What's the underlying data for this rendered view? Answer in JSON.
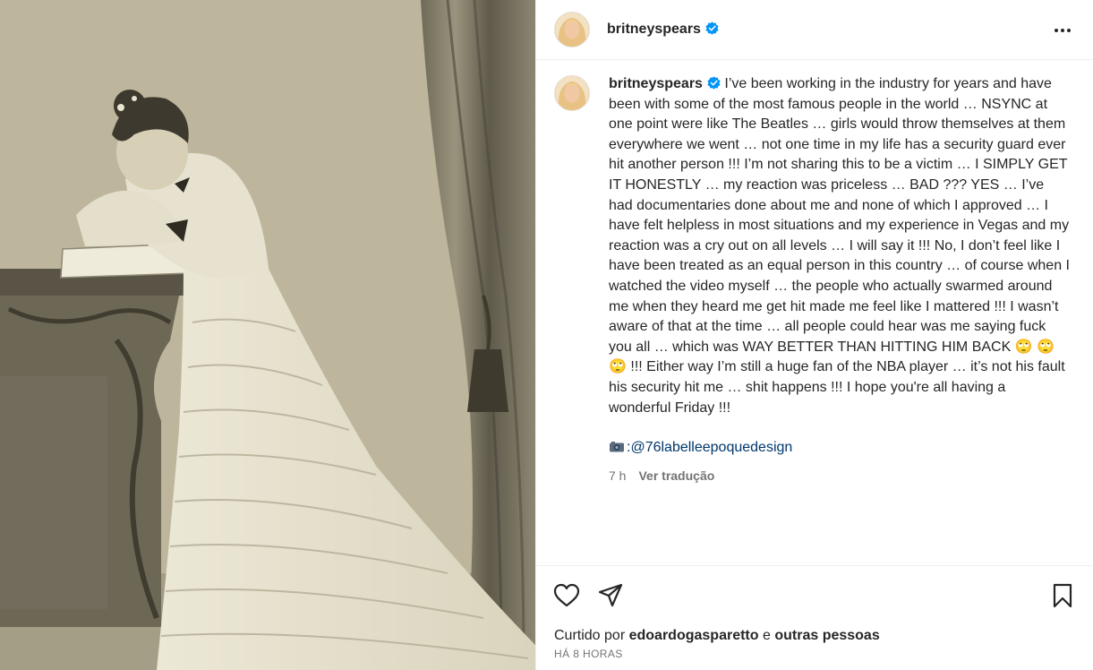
{
  "header": {
    "username": "britneyspears",
    "more_icon": "more-horizontal-icon"
  },
  "caption": {
    "username": "britneyspears",
    "text": "I’ve been working in the industry for years and have been with some of the most famous people in the world … NSYNC at one point were like The Beatles … girls would throw themselves at them everywhere we went … not one time in my life has a security guard ever hit another person !!! I’m not sharing this to be a victim … I SIMPLY GET IT HONESTLY … my reaction was priceless … BAD ??? YES … I’ve had documentaries done about me and none of which I approved … I have felt helpless in most situations and my experience in Vegas and my reaction was a cry out on all levels … I will say it !!! No, I don’t feel like I have been treated as an equal person in this country … of course when I watched the video myself … the people who actually swarmed around me when they heard me get hit made me feel like I mattered !!! I wasn’t aware of that at the time … all people could hear was me saying fuck you all … which was WAY BETTER THAN HITTING HIM BACK 🙄 🙄  🙄 !!! Either way I’m still a huge fan of the NBA player … it’s not his fault his security hit me … shit happens !!! I hope you're all having a wonderful Friday !!!",
    "credit_prefix": ":",
    "credit_handle": "@76labelleepoquedesign",
    "age": "7 h",
    "translate": "Ver tradução"
  },
  "actions": {
    "like_icon": "heart-icon",
    "share_icon": "send-icon",
    "save_icon": "bookmark-icon"
  },
  "likes": {
    "prefix": "Curtido por",
    "user": "edoardogasparetto",
    "joiner": "e",
    "others": "outras pessoas"
  },
  "timestamp": "HÁ 8 HORAS",
  "colors": {
    "verified": "#0095f6",
    "link": "#00376b",
    "muted": "#737373",
    "text": "#262626"
  }
}
